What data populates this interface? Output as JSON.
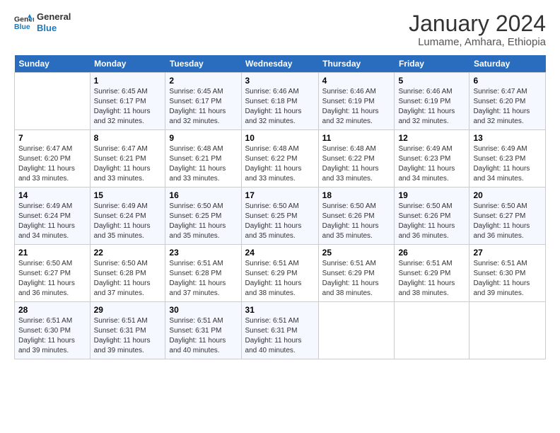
{
  "logo": {
    "text_general": "General",
    "text_blue": "Blue"
  },
  "header": {
    "month_year": "January 2024",
    "location": "Lumame, Amhara, Ethiopia"
  },
  "days_of_week": [
    "Sunday",
    "Monday",
    "Tuesday",
    "Wednesday",
    "Thursday",
    "Friday",
    "Saturday"
  ],
  "weeks": [
    [
      {
        "day": "",
        "sunrise": "",
        "sunset": "",
        "daylight": ""
      },
      {
        "day": "1",
        "sunrise": "Sunrise: 6:45 AM",
        "sunset": "Sunset: 6:17 PM",
        "daylight": "Daylight: 11 hours and 32 minutes."
      },
      {
        "day": "2",
        "sunrise": "Sunrise: 6:45 AM",
        "sunset": "Sunset: 6:17 PM",
        "daylight": "Daylight: 11 hours and 32 minutes."
      },
      {
        "day": "3",
        "sunrise": "Sunrise: 6:46 AM",
        "sunset": "Sunset: 6:18 PM",
        "daylight": "Daylight: 11 hours and 32 minutes."
      },
      {
        "day": "4",
        "sunrise": "Sunrise: 6:46 AM",
        "sunset": "Sunset: 6:19 PM",
        "daylight": "Daylight: 11 hours and 32 minutes."
      },
      {
        "day": "5",
        "sunrise": "Sunrise: 6:46 AM",
        "sunset": "Sunset: 6:19 PM",
        "daylight": "Daylight: 11 hours and 32 minutes."
      },
      {
        "day": "6",
        "sunrise": "Sunrise: 6:47 AM",
        "sunset": "Sunset: 6:20 PM",
        "daylight": "Daylight: 11 hours and 32 minutes."
      }
    ],
    [
      {
        "day": "7",
        "sunrise": "Sunrise: 6:47 AM",
        "sunset": "Sunset: 6:20 PM",
        "daylight": "Daylight: 11 hours and 33 minutes."
      },
      {
        "day": "8",
        "sunrise": "Sunrise: 6:47 AM",
        "sunset": "Sunset: 6:21 PM",
        "daylight": "Daylight: 11 hours and 33 minutes."
      },
      {
        "day": "9",
        "sunrise": "Sunrise: 6:48 AM",
        "sunset": "Sunset: 6:21 PM",
        "daylight": "Daylight: 11 hours and 33 minutes."
      },
      {
        "day": "10",
        "sunrise": "Sunrise: 6:48 AM",
        "sunset": "Sunset: 6:22 PM",
        "daylight": "Daylight: 11 hours and 33 minutes."
      },
      {
        "day": "11",
        "sunrise": "Sunrise: 6:48 AM",
        "sunset": "Sunset: 6:22 PM",
        "daylight": "Daylight: 11 hours and 33 minutes."
      },
      {
        "day": "12",
        "sunrise": "Sunrise: 6:49 AM",
        "sunset": "Sunset: 6:23 PM",
        "daylight": "Daylight: 11 hours and 34 minutes."
      },
      {
        "day": "13",
        "sunrise": "Sunrise: 6:49 AM",
        "sunset": "Sunset: 6:23 PM",
        "daylight": "Daylight: 11 hours and 34 minutes."
      }
    ],
    [
      {
        "day": "14",
        "sunrise": "Sunrise: 6:49 AM",
        "sunset": "Sunset: 6:24 PM",
        "daylight": "Daylight: 11 hours and 34 minutes."
      },
      {
        "day": "15",
        "sunrise": "Sunrise: 6:49 AM",
        "sunset": "Sunset: 6:24 PM",
        "daylight": "Daylight: 11 hours and 35 minutes."
      },
      {
        "day": "16",
        "sunrise": "Sunrise: 6:50 AM",
        "sunset": "Sunset: 6:25 PM",
        "daylight": "Daylight: 11 hours and 35 minutes."
      },
      {
        "day": "17",
        "sunrise": "Sunrise: 6:50 AM",
        "sunset": "Sunset: 6:25 PM",
        "daylight": "Daylight: 11 hours and 35 minutes."
      },
      {
        "day": "18",
        "sunrise": "Sunrise: 6:50 AM",
        "sunset": "Sunset: 6:26 PM",
        "daylight": "Daylight: 11 hours and 35 minutes."
      },
      {
        "day": "19",
        "sunrise": "Sunrise: 6:50 AM",
        "sunset": "Sunset: 6:26 PM",
        "daylight": "Daylight: 11 hours and 36 minutes."
      },
      {
        "day": "20",
        "sunrise": "Sunrise: 6:50 AM",
        "sunset": "Sunset: 6:27 PM",
        "daylight": "Daylight: 11 hours and 36 minutes."
      }
    ],
    [
      {
        "day": "21",
        "sunrise": "Sunrise: 6:50 AM",
        "sunset": "Sunset: 6:27 PM",
        "daylight": "Daylight: 11 hours and 36 minutes."
      },
      {
        "day": "22",
        "sunrise": "Sunrise: 6:50 AM",
        "sunset": "Sunset: 6:28 PM",
        "daylight": "Daylight: 11 hours and 37 minutes."
      },
      {
        "day": "23",
        "sunrise": "Sunrise: 6:51 AM",
        "sunset": "Sunset: 6:28 PM",
        "daylight": "Daylight: 11 hours and 37 minutes."
      },
      {
        "day": "24",
        "sunrise": "Sunrise: 6:51 AM",
        "sunset": "Sunset: 6:29 PM",
        "daylight": "Daylight: 11 hours and 38 minutes."
      },
      {
        "day": "25",
        "sunrise": "Sunrise: 6:51 AM",
        "sunset": "Sunset: 6:29 PM",
        "daylight": "Daylight: 11 hours and 38 minutes."
      },
      {
        "day": "26",
        "sunrise": "Sunrise: 6:51 AM",
        "sunset": "Sunset: 6:29 PM",
        "daylight": "Daylight: 11 hours and 38 minutes."
      },
      {
        "day": "27",
        "sunrise": "Sunrise: 6:51 AM",
        "sunset": "Sunset: 6:30 PM",
        "daylight": "Daylight: 11 hours and 39 minutes."
      }
    ],
    [
      {
        "day": "28",
        "sunrise": "Sunrise: 6:51 AM",
        "sunset": "Sunset: 6:30 PM",
        "daylight": "Daylight: 11 hours and 39 minutes."
      },
      {
        "day": "29",
        "sunrise": "Sunrise: 6:51 AM",
        "sunset": "Sunset: 6:31 PM",
        "daylight": "Daylight: 11 hours and 39 minutes."
      },
      {
        "day": "30",
        "sunrise": "Sunrise: 6:51 AM",
        "sunset": "Sunset: 6:31 PM",
        "daylight": "Daylight: 11 hours and 40 minutes."
      },
      {
        "day": "31",
        "sunrise": "Sunrise: 6:51 AM",
        "sunset": "Sunset: 6:31 PM",
        "daylight": "Daylight: 11 hours and 40 minutes."
      },
      {
        "day": "",
        "sunrise": "",
        "sunset": "",
        "daylight": ""
      },
      {
        "day": "",
        "sunrise": "",
        "sunset": "",
        "daylight": ""
      },
      {
        "day": "",
        "sunrise": "",
        "sunset": "",
        "daylight": ""
      }
    ]
  ]
}
